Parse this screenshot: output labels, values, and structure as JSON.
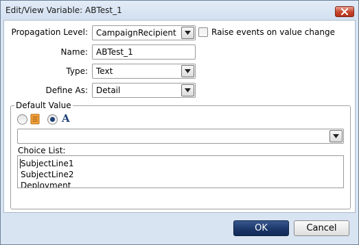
{
  "window": {
    "title": "Edit/View Variable: ABTest_1"
  },
  "form": {
    "propagation_label": "Propagation Level:",
    "propagation_value": "CampaignRecipient",
    "raise_events_label": "Raise events on value change",
    "raise_events_checked": false,
    "name_label": "Name:",
    "name_value": "ABTest_1",
    "type_label": "Type:",
    "type_value": "Text",
    "define_label": "Define As:",
    "define_value": "Detail"
  },
  "default_value": {
    "legend": "Default Value",
    "mode_options": [
      {
        "icon": "radio-empty",
        "checked": false
      },
      {
        "icon": "list-icon",
        "checked": false
      },
      {
        "icon": "text-a-icon",
        "checked": true,
        "glyph": "A"
      }
    ],
    "combo_value": "",
    "choice_list_label": "Choice List:",
    "choice_list": [
      "SubjectLine1",
      "SubjectLine2",
      "Deployment"
    ]
  },
  "footer": {
    "ok_label": "OK",
    "cancel_label": "Cancel"
  },
  "colors": {
    "frame": "#d9e4f2",
    "ok_button": "#1a3568",
    "close_button": "#c6432c"
  }
}
